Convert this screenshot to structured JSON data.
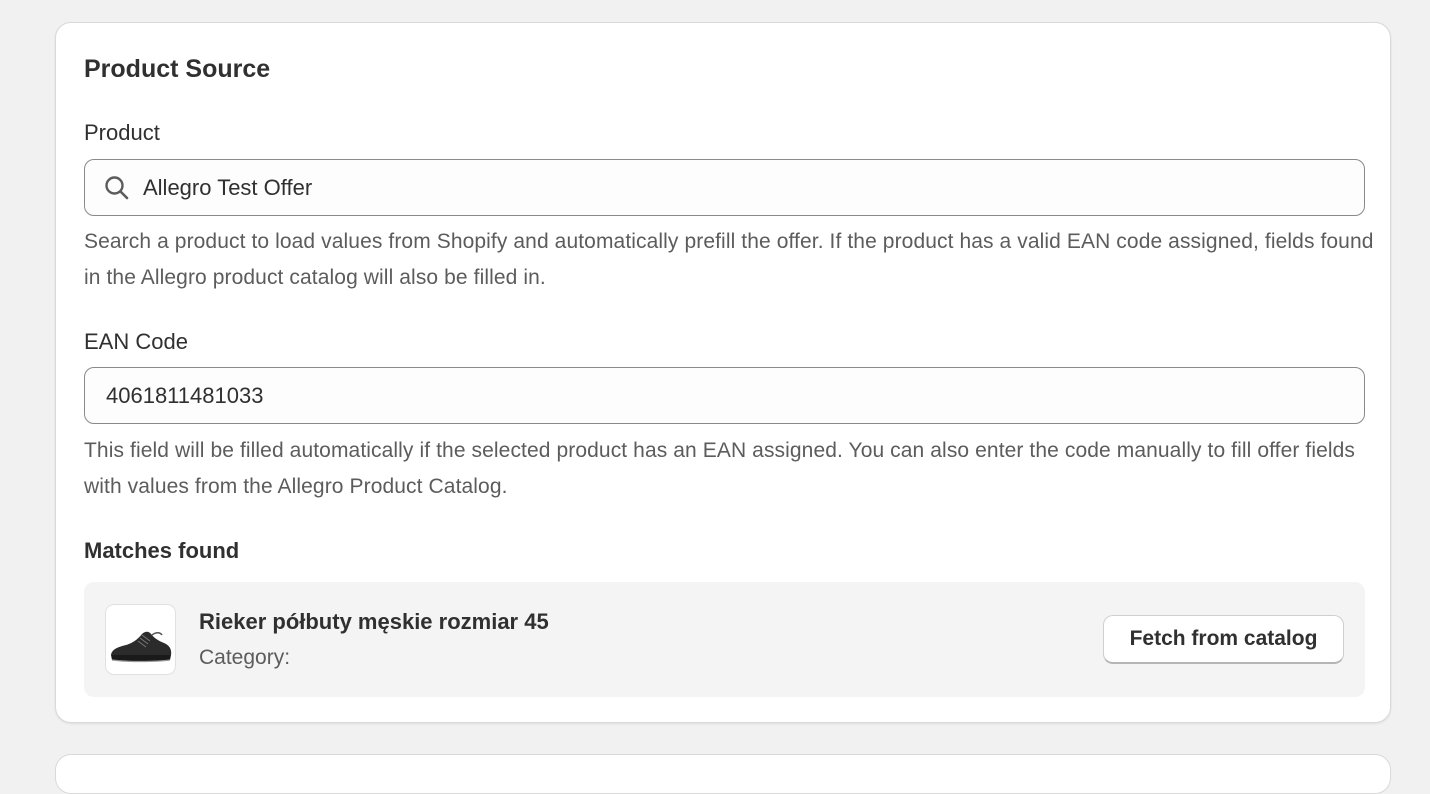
{
  "product_source": {
    "title": "Product Source",
    "product_field": {
      "label": "Product",
      "value": "Allegro Test Offer",
      "icon": "search-icon",
      "help": "Search a product to load values from Shopify and automatically prefill the offer. If the product has a valid EAN code assigned, fields found in the Allegro product catalog will also be filled in."
    },
    "ean_field": {
      "label": "EAN Code",
      "value": "4061811481033",
      "help": "This field will be filled automatically if the selected product has an EAN assigned. You can also enter the code manually to fill offer fields with values from the Allegro Product Catalog."
    },
    "matches": {
      "heading": "Matches found",
      "items": [
        {
          "name": "Rieker półbuty męskie rozmiar 45",
          "category": "Category:",
          "thumbnail": "shoe-image",
          "action_label": "Fetch from catalog"
        }
      ]
    }
  },
  "colors": {
    "background": "#f1f1f1",
    "card": "#ffffff",
    "text": "#303030",
    "muted_text": "#5c5c5c",
    "input_border": "#8a8a8a",
    "match_background": "#f4f4f4"
  }
}
